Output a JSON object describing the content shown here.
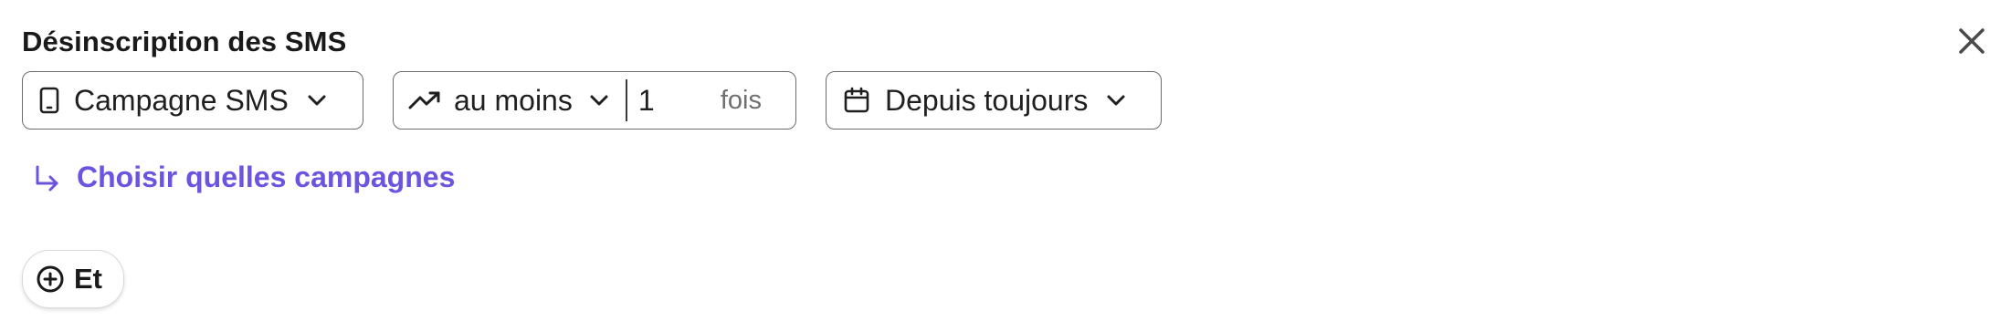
{
  "header": {
    "title": "Désinscription des SMS",
    "close_icon": "close-icon"
  },
  "filters": {
    "campaign": {
      "label": "Campagne SMS",
      "icon": "phone-icon"
    },
    "frequency": {
      "operator": "au moins",
      "operator_icon": "trending-up-icon",
      "count": "1",
      "unit": "fois"
    },
    "period": {
      "label": "Depuis toujours",
      "icon": "calendar-icon"
    }
  },
  "choose_link": {
    "label": "Choisir quelles campagnes",
    "icon": "arrow-turn-down-right-icon"
  },
  "and_button": {
    "label": "Et",
    "icon": "plus-circle-icon"
  },
  "colors": {
    "accent": "#6a54e0",
    "border": "#6b6b6b",
    "text": "#1f1f1f",
    "muted": "#6f6f6f"
  }
}
